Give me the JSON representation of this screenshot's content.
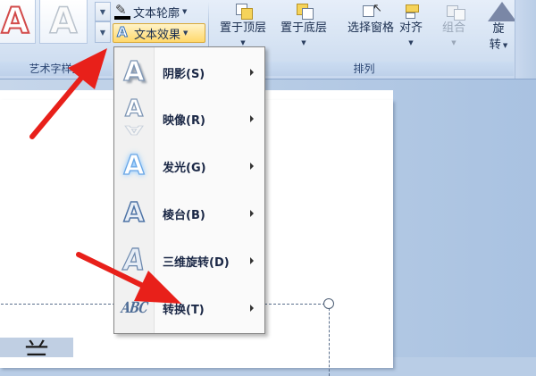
{
  "ribbon": {
    "wordart_gallery": {
      "tiles": [
        "A",
        "A"
      ],
      "group_label": "艺术字样式"
    },
    "text_outline_label": "文本轮廓",
    "text_effects_label": "文本效果",
    "arrange": {
      "group_label": "排列",
      "bring_to_front": "置于顶层",
      "send_to_back": "置于底层",
      "selection_pane": "选择窗格",
      "align": "对齐",
      "group": "组合",
      "rotate_line1": "旋",
      "rotate_line2": "转"
    }
  },
  "effects_menu": {
    "items": [
      {
        "label": "阴影(S)",
        "icon": "shadow-a-icon"
      },
      {
        "label": "映像(R)",
        "icon": "reflection-a-icon"
      },
      {
        "label": "发光(G)",
        "icon": "glow-a-icon"
      },
      {
        "label": "棱台(B)",
        "icon": "bevel-a-icon"
      },
      {
        "label": "三维旋转(D)",
        "icon": "3d-rotation-a-icon"
      },
      {
        "label": "转换(T)",
        "icon": "transform-abc-icon"
      }
    ],
    "icon_letter": "A",
    "transform_icon_text": "ABC"
  },
  "document": {
    "selected_text": "兰"
  },
  "colors": {
    "accent_highlight": "#ffd86b",
    "annotation_arrow": "#e8201a",
    "menu_text": "#1a2745"
  }
}
